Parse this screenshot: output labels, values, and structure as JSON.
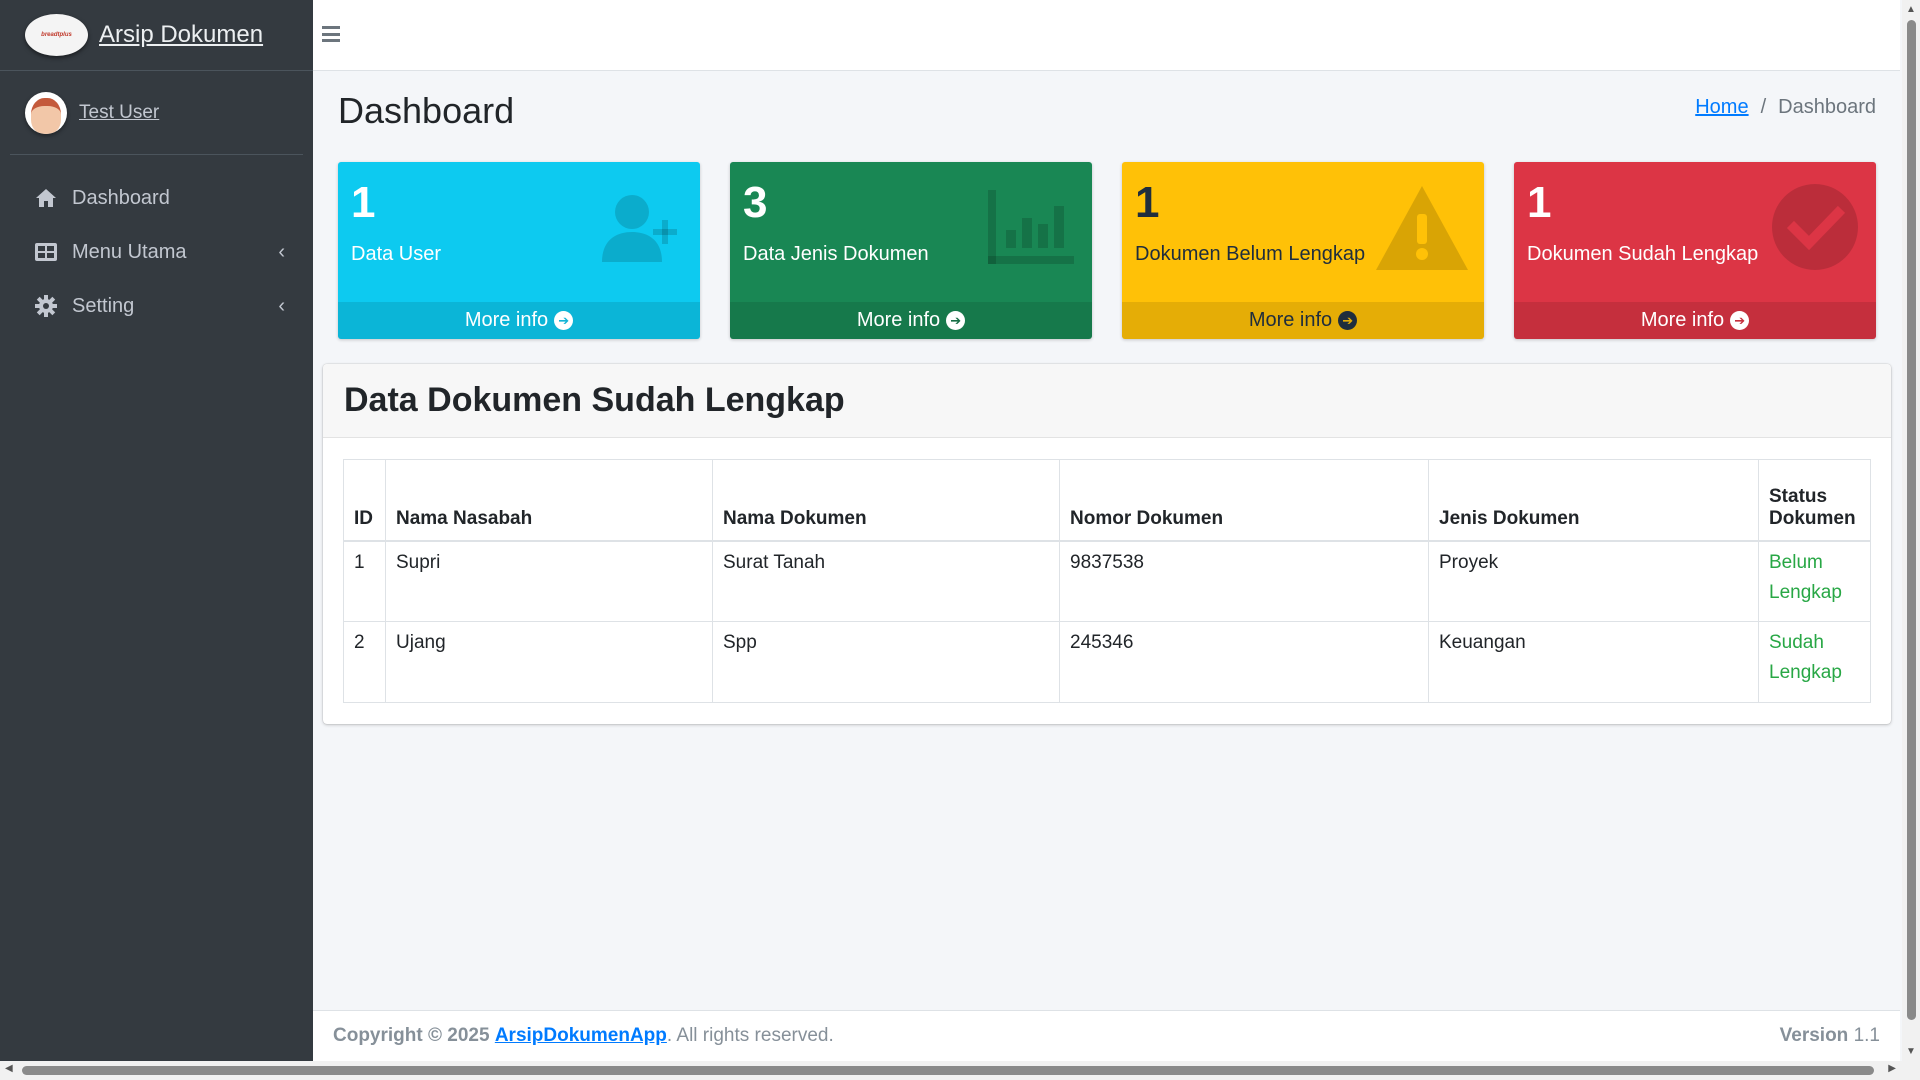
{
  "brand": {
    "title": "Arsip Dokumen",
    "logo_text": "breadtplus"
  },
  "user": {
    "name": "Test User"
  },
  "sidebar": {
    "items": [
      {
        "label": "Dashboard",
        "icon": "home-icon"
      },
      {
        "label": "Menu Utama",
        "icon": "table-icon",
        "arrow": "‹"
      },
      {
        "label": "Setting",
        "icon": "gear-icon",
        "arrow": "‹"
      }
    ]
  },
  "header": {
    "title": "Dashboard",
    "breadcrumb": {
      "home": "Home",
      "separator": "/",
      "current": "Dashboard"
    }
  },
  "boxes": [
    {
      "value": "1",
      "label": "Data User",
      "more": "More info",
      "color": "#0dcaf0",
      "icon": "user-plus-icon"
    },
    {
      "value": "3",
      "label": "Data Jenis Dokumen",
      "more": "More info",
      "color": "#198754",
      "icon": "bar-chart-icon"
    },
    {
      "value": "1",
      "label": "Dokumen Belum Lengkap",
      "more": "More info",
      "color": "#ffc107",
      "icon": "warning-icon"
    },
    {
      "value": "1",
      "label": "Dokumen Sudah Lengkap",
      "more": "More info",
      "color": "#dc3545",
      "icon": "check-circle-icon"
    }
  ],
  "table_card": {
    "title": "Data Dokumen Sudah Lengkap",
    "columns": [
      "ID",
      "Nama Nasabah",
      "Nama Dokumen",
      "Nomor Dokumen",
      "Jenis Dokumen",
      "Status Dokumen"
    ],
    "rows": [
      [
        "1",
        "Supri",
        "Surat Tanah",
        "9837538",
        "Proyek",
        "Belum Lengkap"
      ],
      [
        "2",
        "Ujang",
        "Spp",
        "245346",
        "Keuangan",
        "Sudah Lengkap"
      ]
    ],
    "status_color": "#28a745"
  },
  "footer": {
    "copyright_prefix": "Copyright © 2025",
    "app_link": "ArsipDokumenApp",
    "suffix": ". All rights reserved.",
    "version_label": "Version",
    "version": "1.1"
  }
}
